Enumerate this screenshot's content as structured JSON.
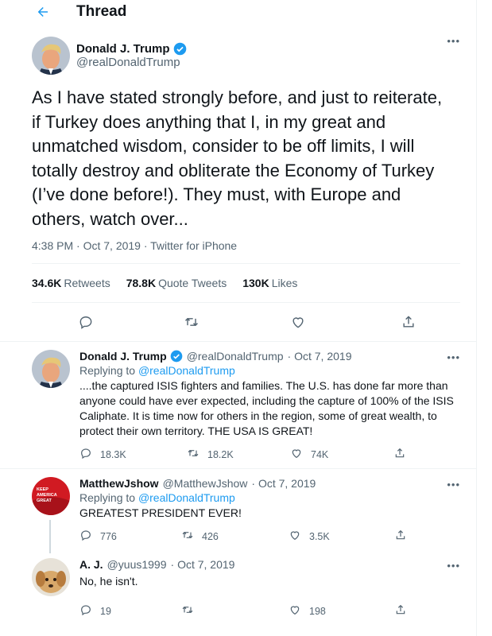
{
  "header": {
    "title": "Thread"
  },
  "main_tweet": {
    "name": "Donald J. Trump",
    "handle": "@realDonaldTrump",
    "text": "As I have stated strongly before, and just to reiterate, if Turkey does anything that I, in my great and unmatched wisdom, consider to be off limits, I will totally destroy and obliterate the Economy of Turkey (I’ve done before!). They must, with Europe and others, watch over...",
    "meta": "4:38 PM · Oct 7, 2019 · Twitter for iPhone",
    "stats": [
      {
        "count": "34.6K",
        "label": "Retweets"
      },
      {
        "count": "78.8K",
        "label": "Quote Tweets"
      },
      {
        "count": "130K",
        "label": "Likes"
      }
    ]
  },
  "replies": [
    {
      "name": "Donald J. Trump",
      "handle": "@realDonaldTrump",
      "date": "· Oct 7, 2019",
      "replying_prefix": "Replying to",
      "replying_to": "@realDonaldTrump",
      "text": "....the captured ISIS fighters and families. The U.S. has done far more than anyone could have ever expected, including the capture of 100% of the ISIS Caliphate. It is time now for others in the region, some of great wealth, to protect their own territory. THE USA IS GREAT!",
      "replies": "18.3K",
      "retweets": "18.2K",
      "likes": "74K"
    },
    {
      "name": "MatthewJshow",
      "handle": "@MatthewJshow",
      "date": "· Oct 7, 2019",
      "replying_prefix": "Replying to",
      "replying_to": "@realDonaldTrump",
      "text": "GREATEST PRESIDENT EVER!",
      "replies": "776",
      "retweets": "426",
      "likes": "3.5K",
      "hat_text": "KEEP AMERICA GREAT"
    },
    {
      "name": "A. J.",
      "handle": "@yuus1999",
      "date": "· Oct 7, 2019",
      "text": "No, he isn't.",
      "replies": "19",
      "retweets": "",
      "likes": "198"
    }
  ],
  "colors": {
    "accent": "#1d9bf0",
    "text": "#0f1419",
    "muted": "#536471"
  },
  "icons": [
    "back-arrow-icon",
    "verified-badge-icon",
    "more-icon",
    "reply-icon",
    "retweet-icon",
    "like-icon",
    "share-icon"
  ]
}
